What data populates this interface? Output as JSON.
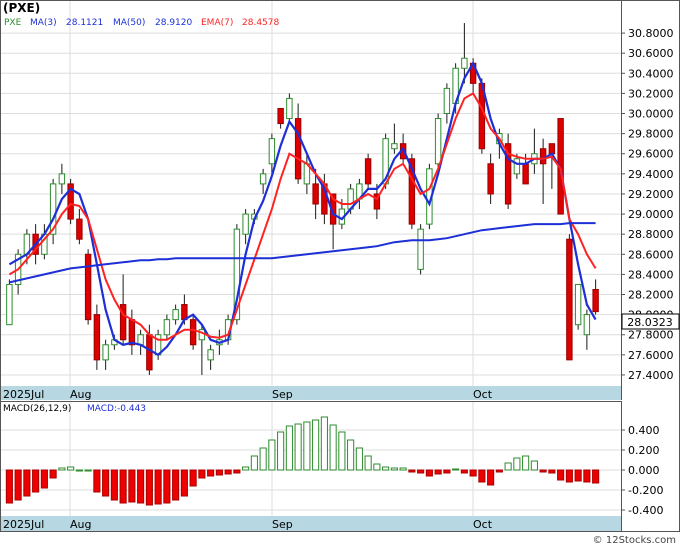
{
  "header": {
    "title": "(PXE)",
    "legend_symbol": "PXE",
    "ma3_label": "MA(3)",
    "ma3_value": "28.1121",
    "ma50_label": "MA(50)",
    "ma50_value": "28.9120",
    "ema7_label": "EMA(7)",
    "ema7_value": "28.4578"
  },
  "last_price_badge": "28.0323",
  "watermark": "© 12Stocks.com",
  "colors": {
    "up_candle": "#2e8b2e",
    "down_candle": "#dd0000",
    "ma3": "#1d2fd6",
    "ma50": "#1d2fd6",
    "ema7": "#ff2222",
    "axis_band": "#b7d8e3",
    "macd_bar_up": "#2e8b2e",
    "macd_bar_down": "#ee0000"
  },
  "chart_data": [
    {
      "type": "candlestick",
      "title": "(PXE)",
      "x_labels": [
        "2025Jul",
        "Aug",
        "Sep",
        "Oct"
      ],
      "y_ticks": [
        "30.8000",
        "30.6000",
        "30.4000",
        "30.2000",
        "30.0000",
        "29.8000",
        "29.6000",
        "29.4000",
        "29.2000",
        "29.0000",
        "28.8000",
        "28.6000",
        "28.4000",
        "28.2000",
        "28.0000",
        "27.8000",
        "27.6000",
        "27.4000"
      ],
      "ylim": [
        27.3,
        30.95
      ],
      "candles": [
        {
          "o": 27.9,
          "h": 28.35,
          "l": 27.9,
          "c": 28.3
        },
        {
          "o": 28.3,
          "h": 28.65,
          "l": 28.2,
          "c": 28.6
        },
        {
          "o": 28.6,
          "h": 28.85,
          "l": 28.5,
          "c": 28.8
        },
        {
          "o": 28.8,
          "h": 28.9,
          "l": 28.5,
          "c": 28.6
        },
        {
          "o": 28.6,
          "h": 28.9,
          "l": 28.55,
          "c": 28.8
        },
        {
          "o": 28.8,
          "h": 29.35,
          "l": 28.7,
          "c": 29.3
        },
        {
          "o": 29.3,
          "h": 29.5,
          "l": 29.2,
          "c": 29.4
        },
        {
          "o": 29.3,
          "h": 29.35,
          "l": 28.9,
          "c": 28.95
        },
        {
          "o": 28.95,
          "h": 29.05,
          "l": 28.7,
          "c": 28.75
        },
        {
          "o": 28.6,
          "h": 28.65,
          "l": 27.9,
          "c": 27.95
        },
        {
          "o": 28.0,
          "h": 28.1,
          "l": 27.45,
          "c": 27.55
        },
        {
          "o": 27.55,
          "h": 27.75,
          "l": 27.45,
          "c": 27.7
        },
        {
          "o": 27.7,
          "h": 27.8,
          "l": 27.65,
          "c": 27.75
        },
        {
          "o": 28.1,
          "h": 28.4,
          "l": 27.7,
          "c": 27.75
        },
        {
          "o": 27.95,
          "h": 28.05,
          "l": 27.6,
          "c": 27.7
        },
        {
          "o": 27.7,
          "h": 27.85,
          "l": 27.6,
          "c": 27.8
        },
        {
          "o": 27.8,
          "h": 27.9,
          "l": 27.4,
          "c": 27.45
        },
        {
          "o": 27.6,
          "h": 27.85,
          "l": 27.55,
          "c": 27.8
        },
        {
          "o": 27.8,
          "h": 28.0,
          "l": 27.75,
          "c": 27.95
        },
        {
          "o": 27.95,
          "h": 28.1,
          "l": 27.9,
          "c": 28.05
        },
        {
          "o": 28.1,
          "h": 28.2,
          "l": 27.9,
          "c": 27.95
        },
        {
          "o": 27.95,
          "h": 28.0,
          "l": 27.65,
          "c": 27.7
        },
        {
          "o": 27.75,
          "h": 27.9,
          "l": 27.4,
          "c": 27.85
        },
        {
          "o": 27.55,
          "h": 27.7,
          "l": 27.45,
          "c": 27.65
        },
        {
          "o": 27.7,
          "h": 27.85,
          "l": 27.6,
          "c": 27.75
        },
        {
          "o": 27.75,
          "h": 28.0,
          "l": 27.7,
          "c": 27.95
        },
        {
          "o": 27.95,
          "h": 28.9,
          "l": 27.9,
          "c": 28.85
        },
        {
          "o": 28.8,
          "h": 29.05,
          "l": 28.7,
          "c": 29.0
        },
        {
          "o": 28.95,
          "h": 29.05,
          "l": 28.9,
          "c": 29.0
        },
        {
          "o": 29.3,
          "h": 29.45,
          "l": 29.2,
          "c": 29.4
        },
        {
          "o": 29.5,
          "h": 29.8,
          "l": 29.4,
          "c": 29.75
        },
        {
          "o": 30.05,
          "h": 30.05,
          "l": 29.85,
          "c": 29.9
        },
        {
          "o": 29.95,
          "h": 30.2,
          "l": 29.9,
          "c": 30.15
        },
        {
          "o": 29.95,
          "h": 30.1,
          "l": 29.3,
          "c": 29.35
        },
        {
          "o": 29.3,
          "h": 29.6,
          "l": 29.2,
          "c": 29.5
        },
        {
          "o": 29.3,
          "h": 29.45,
          "l": 28.95,
          "c": 29.1
        },
        {
          "o": 29.3,
          "h": 29.4,
          "l": 28.9,
          "c": 29.0
        },
        {
          "o": 29.2,
          "h": 29.2,
          "l": 28.65,
          "c": 28.9
        },
        {
          "o": 28.9,
          "h": 29.15,
          "l": 28.85,
          "c": 29.05
        },
        {
          "o": 29.05,
          "h": 29.3,
          "l": 29.0,
          "c": 29.25
        },
        {
          "o": 29.15,
          "h": 29.35,
          "l": 29.05,
          "c": 29.3
        },
        {
          "o": 29.55,
          "h": 29.6,
          "l": 29.25,
          "c": 29.3
        },
        {
          "o": 29.2,
          "h": 29.3,
          "l": 28.95,
          "c": 29.05
        },
        {
          "o": 29.3,
          "h": 29.8,
          "l": 29.25,
          "c": 29.75
        },
        {
          "o": 29.65,
          "h": 29.9,
          "l": 29.6,
          "c": 29.7
        },
        {
          "o": 29.7,
          "h": 29.8,
          "l": 29.5,
          "c": 29.55
        },
        {
          "o": 29.55,
          "h": 29.6,
          "l": 28.85,
          "c": 28.9
        },
        {
          "o": 28.45,
          "h": 28.9,
          "l": 28.4,
          "c": 28.85
        },
        {
          "o": 28.9,
          "h": 29.5,
          "l": 28.85,
          "c": 29.45
        },
        {
          "o": 29.5,
          "h": 30.0,
          "l": 29.4,
          "c": 29.95
        },
        {
          "o": 30.0,
          "h": 30.3,
          "l": 29.9,
          "c": 30.25
        },
        {
          "o": 30.1,
          "h": 30.5,
          "l": 30.0,
          "c": 30.45
        },
        {
          "o": 30.45,
          "h": 30.9,
          "l": 30.3,
          "c": 30.55
        },
        {
          "o": 30.5,
          "h": 30.55,
          "l": 30.2,
          "c": 30.3
        },
        {
          "o": 30.3,
          "h": 30.35,
          "l": 29.6,
          "c": 29.65
        },
        {
          "o": 29.5,
          "h": 29.6,
          "l": 29.1,
          "c": 29.2
        },
        {
          "o": 29.7,
          "h": 29.85,
          "l": 29.55,
          "c": 29.8
        },
        {
          "o": 29.7,
          "h": 29.8,
          "l": 29.05,
          "c": 29.1
        },
        {
          "o": 29.4,
          "h": 29.6,
          "l": 29.35,
          "c": 29.55
        },
        {
          "o": 29.5,
          "h": 29.6,
          "l": 29.3,
          "c": 29.3
        },
        {
          "o": 29.5,
          "h": 29.85,
          "l": 29.4,
          "c": 29.6
        },
        {
          "o": 29.65,
          "h": 29.75,
          "l": 29.1,
          "c": 29.5
        },
        {
          "o": 29.7,
          "h": 29.7,
          "l": 29.25,
          "c": 29.6
        },
        {
          "o": 29.95,
          "h": 29.95,
          "l": 29.0,
          "c": 29.0
        },
        {
          "o": 28.75,
          "h": 28.8,
          "l": 27.55,
          "c": 27.55
        },
        {
          "o": 27.9,
          "h": 28.3,
          "l": 27.85,
          "c": 28.3
        },
        {
          "o": 27.8,
          "h": 28.05,
          "l": 27.65,
          "c": 28.0
        },
        {
          "o": 28.25,
          "h": 28.35,
          "l": 28.0,
          "c": 28.03
        }
      ],
      "series": [
        {
          "name": "MA(3)",
          "values": [
            28.5,
            28.55,
            28.6,
            28.7,
            28.8,
            28.95,
            29.15,
            29.25,
            29.2,
            28.95,
            28.5,
            28.05,
            27.75,
            27.7,
            27.72,
            27.7,
            27.65,
            27.6,
            27.68,
            27.8,
            27.95,
            28.0,
            27.9,
            27.75,
            27.72,
            27.75,
            28.15,
            28.6,
            28.95,
            29.13,
            29.38,
            29.68,
            29.92,
            29.8,
            29.6,
            29.4,
            29.25,
            29.0,
            28.95,
            29.05,
            29.15,
            29.25,
            29.25,
            29.35,
            29.55,
            29.65,
            29.45,
            29.25,
            29.1,
            29.4,
            29.75,
            30.1,
            30.35,
            30.5,
            30.3,
            29.95,
            29.7,
            29.55,
            29.5,
            29.5,
            29.55,
            29.55,
            29.6,
            29.45,
            28.95,
            28.5,
            28.1,
            27.95
          ]
        },
        {
          "name": "EMA(7)",
          "values": [
            28.4,
            28.45,
            28.55,
            28.65,
            28.75,
            28.85,
            29.0,
            29.1,
            29.08,
            28.95,
            28.65,
            28.35,
            28.15,
            28.0,
            27.95,
            27.9,
            27.8,
            27.75,
            27.75,
            27.8,
            27.85,
            27.85,
            27.82,
            27.78,
            27.77,
            27.8,
            28.05,
            28.3,
            28.55,
            28.8,
            29.05,
            29.35,
            29.6,
            29.55,
            29.5,
            29.4,
            29.3,
            29.15,
            29.1,
            29.1,
            29.15,
            29.2,
            29.15,
            29.3,
            29.45,
            29.5,
            29.35,
            29.2,
            29.25,
            29.45,
            29.7,
            29.95,
            30.15,
            30.2,
            30.05,
            29.85,
            29.75,
            29.6,
            29.57,
            29.55,
            29.55,
            29.55,
            29.57,
            29.45,
            28.95,
            28.8,
            28.6,
            28.46
          ]
        },
        {
          "name": "MA(50)",
          "values": [
            28.32,
            28.34,
            28.36,
            28.38,
            28.4,
            28.42,
            28.44,
            28.46,
            28.47,
            28.48,
            28.49,
            28.5,
            28.51,
            28.52,
            28.53,
            28.54,
            28.54,
            28.55,
            28.55,
            28.56,
            28.56,
            28.56,
            28.56,
            28.56,
            28.56,
            28.56,
            28.56,
            28.56,
            28.56,
            28.56,
            28.56,
            28.57,
            28.58,
            28.59,
            28.6,
            28.61,
            28.62,
            28.63,
            28.64,
            28.65,
            28.66,
            28.67,
            28.68,
            28.7,
            28.72,
            28.73,
            28.74,
            28.74,
            28.74,
            28.75,
            28.76,
            28.78,
            28.8,
            28.82,
            28.84,
            28.85,
            28.86,
            28.87,
            28.88,
            28.89,
            28.9,
            28.9,
            28.9,
            28.9,
            28.91,
            28.91,
            28.91,
            28.91
          ]
        }
      ]
    },
    {
      "type": "bar",
      "title": "MACD(26,12,9)",
      "macd_label": "MACD:-0.443",
      "x_labels": [
        "2025Jul",
        "Aug",
        "Sep",
        "Oct"
      ],
      "y_ticks": [
        "0.400",
        "0.200",
        "0.000",
        "-0.200",
        "-0.400"
      ],
      "ylim": [
        -0.46,
        0.56
      ],
      "values": [
        -0.33,
        -0.3,
        -0.26,
        -0.22,
        -0.18,
        -0.08,
        0.02,
        0.03,
        0.0,
        0.0,
        -0.22,
        -0.26,
        -0.3,
        -0.33,
        -0.32,
        -0.33,
        -0.35,
        -0.34,
        -0.33,
        -0.3,
        -0.26,
        -0.16,
        -0.08,
        -0.06,
        -0.05,
        -0.04,
        -0.03,
        0.03,
        0.14,
        0.22,
        0.3,
        0.38,
        0.44,
        0.46,
        0.48,
        0.5,
        0.53,
        0.45,
        0.38,
        0.3,
        0.22,
        0.14,
        0.06,
        0.03,
        0.02,
        0.02,
        -0.02,
        -0.03,
        -0.06,
        -0.04,
        -0.03,
        0.01,
        -0.03,
        -0.06,
        -0.12,
        -0.15,
        -0.02,
        0.07,
        0.12,
        0.14,
        0.09,
        -0.02,
        -0.03,
        -0.1,
        -0.12,
        -0.11,
        -0.12,
        -0.13
      ]
    }
  ]
}
